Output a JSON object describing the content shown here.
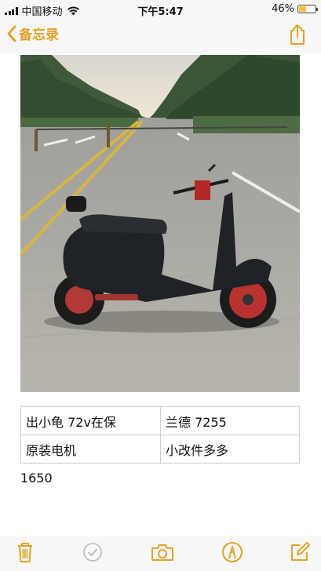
{
  "status_bar": {
    "carrier": "中国移动",
    "time": "下午5:47",
    "battery_percent": "46%",
    "battery_level": 0.46,
    "battery_color": "#f4c23a"
  },
  "nav": {
    "back_label": "备忘录",
    "back_icon": "chevron-left-icon",
    "share_icon": "share-icon",
    "accent_color": "#e0a32a"
  },
  "note": {
    "photo_alt": "scooter-photo",
    "table": [
      [
        "出小龟 72v在保",
        "兰德 7255"
      ],
      [
        "原装电机",
        "小改件多多"
      ]
    ],
    "text": "1650"
  },
  "toolbar": {
    "icons": [
      "trash-icon",
      "checklist-icon",
      "camera-icon",
      "markup-pen-icon",
      "compose-icon"
    ]
  }
}
